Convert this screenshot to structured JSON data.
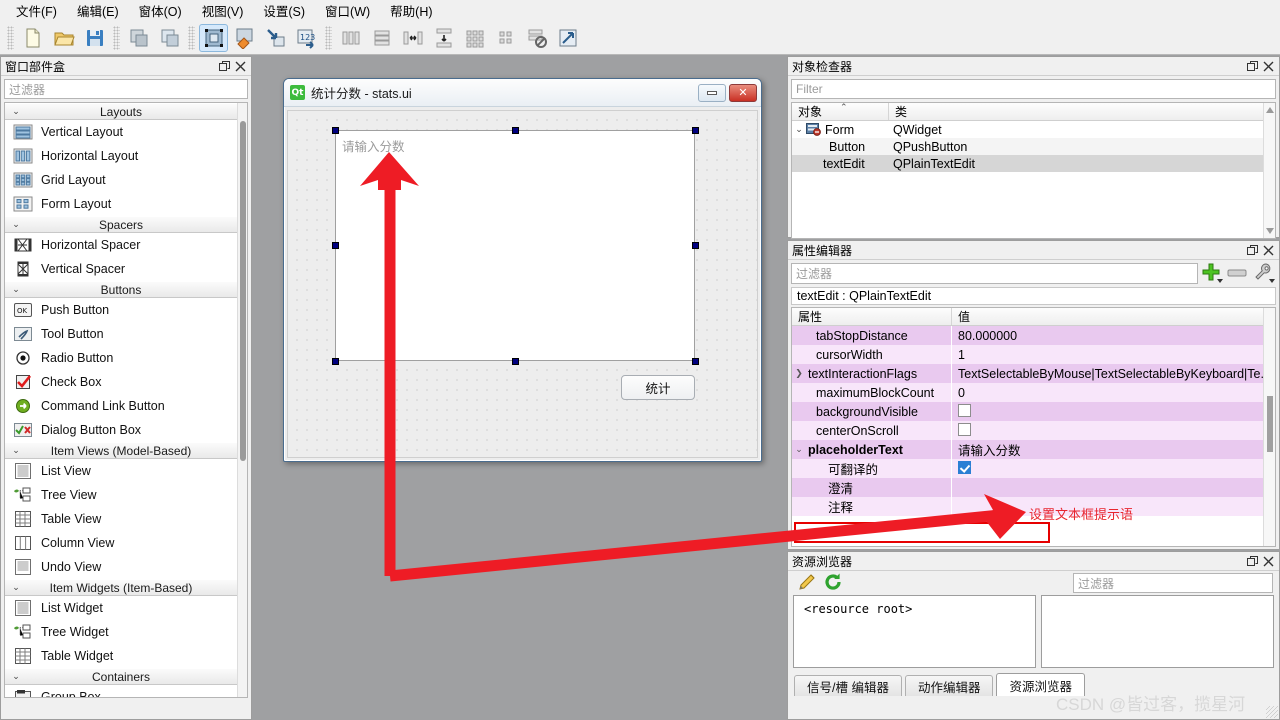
{
  "menu": {
    "items": [
      {
        "label": "文件(F)"
      },
      {
        "label": "编辑(E)"
      },
      {
        "label": "窗体(O)"
      },
      {
        "label": "视图(V)"
      },
      {
        "label": "设置(S)"
      },
      {
        "label": "窗口(W)"
      },
      {
        "label": "帮助(H)"
      }
    ]
  },
  "toolbar": {
    "buttons": [
      {
        "name": "new-form",
        "icon": "new-document-icon"
      },
      {
        "name": "open-form",
        "icon": "open-folder-icon"
      },
      {
        "name": "save-form",
        "icon": "save-floppy-icon"
      },
      {
        "name": "undo",
        "icon": "copy-windows-icon"
      },
      {
        "name": "redo",
        "icon": "paste-windows-icon"
      },
      {
        "name": "edit-widgets",
        "icon": "edit-widgets-icon"
      },
      {
        "name": "edit-signals-slots",
        "icon": "signals-slots-icon"
      },
      {
        "name": "edit-buddies",
        "icon": "buddy-icon"
      },
      {
        "name": "edit-tab-order",
        "icon": "tab-order-icon"
      },
      {
        "name": "layout-horizontally",
        "icon": "layout-horizontal-icon"
      },
      {
        "name": "layout-vertically",
        "icon": "layout-vertical-icon"
      },
      {
        "name": "layout-splitter-horizontal",
        "icon": "splitter-h-icon"
      },
      {
        "name": "layout-splitter-vertical",
        "icon": "splitter-v-icon"
      },
      {
        "name": "layout-grid",
        "icon": "grid-layout-icon"
      },
      {
        "name": "layout-form",
        "icon": "form-layout-icon"
      },
      {
        "name": "break-layout",
        "icon": "break-layout-icon"
      },
      {
        "name": "adjust-size",
        "icon": "adjust-size-icon"
      }
    ]
  },
  "widget_box": {
    "title": "窗口部件盒",
    "filter_placeholder": "过滤器",
    "categories": [
      {
        "name": "Layouts",
        "items": [
          {
            "label": "Vertical Layout",
            "icon": "vertical-layout-icon"
          },
          {
            "label": "Horizontal Layout",
            "icon": "horizontal-layout-icon"
          },
          {
            "label": "Grid Layout",
            "icon": "grid-layout-icon"
          },
          {
            "label": "Form Layout",
            "icon": "form-layout-icon"
          }
        ]
      },
      {
        "name": "Spacers",
        "items": [
          {
            "label": "Horizontal Spacer",
            "icon": "horizontal-spacer-icon"
          },
          {
            "label": "Vertical Spacer",
            "icon": "vertical-spacer-icon"
          }
        ]
      },
      {
        "name": "Buttons",
        "items": [
          {
            "label": "Push Button",
            "icon": "push-button-icon"
          },
          {
            "label": "Tool Button",
            "icon": "tool-button-icon"
          },
          {
            "label": "Radio Button",
            "icon": "radio-button-icon"
          },
          {
            "label": "Check Box",
            "icon": "check-box-icon"
          },
          {
            "label": "Command Link Button",
            "icon": "command-link-icon"
          },
          {
            "label": "Dialog Button Box",
            "icon": "dialog-button-box-icon"
          }
        ]
      },
      {
        "name": "Item Views (Model-Based)",
        "items": [
          {
            "label": "List View",
            "icon": "list-view-icon"
          },
          {
            "label": "Tree View",
            "icon": "tree-view-icon"
          },
          {
            "label": "Table View",
            "icon": "table-view-icon"
          },
          {
            "label": "Column View",
            "icon": "column-view-icon"
          },
          {
            "label": "Undo View",
            "icon": "undo-view-icon"
          }
        ]
      },
      {
        "name": "Item Widgets (Item-Based)",
        "items": [
          {
            "label": "List Widget",
            "icon": "list-widget-icon"
          },
          {
            "label": "Tree Widget",
            "icon": "tree-widget-icon"
          },
          {
            "label": "Table Widget",
            "icon": "table-widget-icon"
          }
        ]
      },
      {
        "name": "Containers",
        "items": [
          {
            "label": "Group Box",
            "icon": "group-box-icon"
          }
        ]
      }
    ]
  },
  "form_window": {
    "title": "统计分数 - stats.ui",
    "logo_text": "Qt",
    "minimize_label": "",
    "close_label": "✕",
    "text_edit_placeholder": "请输入分数",
    "button_label": "统计"
  },
  "object_inspector": {
    "title": "对象检查器",
    "filter_placeholder": "Filter",
    "columns": [
      "对象",
      "类"
    ],
    "rows": [
      {
        "object": "Form",
        "class": "QWidget",
        "level": 0,
        "expandable": true
      },
      {
        "object": "Button",
        "class": "QPushButton",
        "level": 1,
        "expandable": false
      },
      {
        "object": "textEdit",
        "class": "QPlainTextEdit",
        "level": 1,
        "expandable": false,
        "selected": true
      }
    ]
  },
  "property_editor": {
    "title": "属性编辑器",
    "filter_placeholder": "过滤器",
    "object_line": "textEdit : QPlainTextEdit",
    "columns": [
      "属性",
      "值"
    ],
    "rows": [
      {
        "key": "tabStopDistance",
        "value": "80.000000",
        "indent": 1,
        "expandable": false,
        "type": "text"
      },
      {
        "key": "cursorWidth",
        "value": "1",
        "indent": 1,
        "expandable": false,
        "type": "text"
      },
      {
        "key": "textInteractionFlags",
        "value": "TextSelectableByMouse|TextSelectableByKeyboard|Te...",
        "indent": 0,
        "expandable": true,
        "type": "text"
      },
      {
        "key": "maximumBlockCount",
        "value": "0",
        "indent": 1,
        "expandable": false,
        "type": "text"
      },
      {
        "key": "backgroundVisible",
        "value": "",
        "indent": 1,
        "expandable": false,
        "type": "checkbox",
        "checked": false
      },
      {
        "key": "centerOnScroll",
        "value": "",
        "indent": 1,
        "expandable": false,
        "type": "checkbox",
        "checked": false
      },
      {
        "key": "placeholderText",
        "value": "请输入分数",
        "indent": 0,
        "expandable": true,
        "type": "text",
        "bold": true,
        "highlighted": true
      },
      {
        "key": "可翻译的",
        "value": "",
        "indent": 2,
        "expandable": false,
        "type": "checkbox",
        "checked": true
      },
      {
        "key": "澄清",
        "value": "",
        "indent": 2,
        "expandable": false,
        "type": "text"
      },
      {
        "key": "注释",
        "value": "",
        "indent": 2,
        "expandable": false,
        "type": "text"
      }
    ],
    "toolbar_icons": [
      "add-plus-icon",
      "remove-minus-icon",
      "configure-wrench-icon"
    ]
  },
  "resource_browser": {
    "title": "资源浏览器",
    "filter_placeholder": "过滤器",
    "edit_icon": "pencil-edit-icon",
    "reload_icon": "reload-refresh-icon",
    "root_label": "<resource root>",
    "tabs": [
      {
        "label": "信号/槽 编辑器",
        "active": false
      },
      {
        "label": "动作编辑器",
        "active": false
      },
      {
        "label": "资源浏览器",
        "active": true
      }
    ]
  },
  "annotations": {
    "callout_text": "设置文本框提示语",
    "arrow_color": "#ee1c25"
  },
  "watermark": "CSDN @皆过客，揽星河",
  "colors": {
    "window_bg": "#9fa0a2",
    "panel_bg": "#f0f0f0",
    "property_row_dark": "#e9c9ef",
    "property_row_light": "#f8e6fa",
    "highlight_red": "#e60000",
    "selection_handle": "#00007f",
    "accent_blue": "#d6e9fb"
  }
}
